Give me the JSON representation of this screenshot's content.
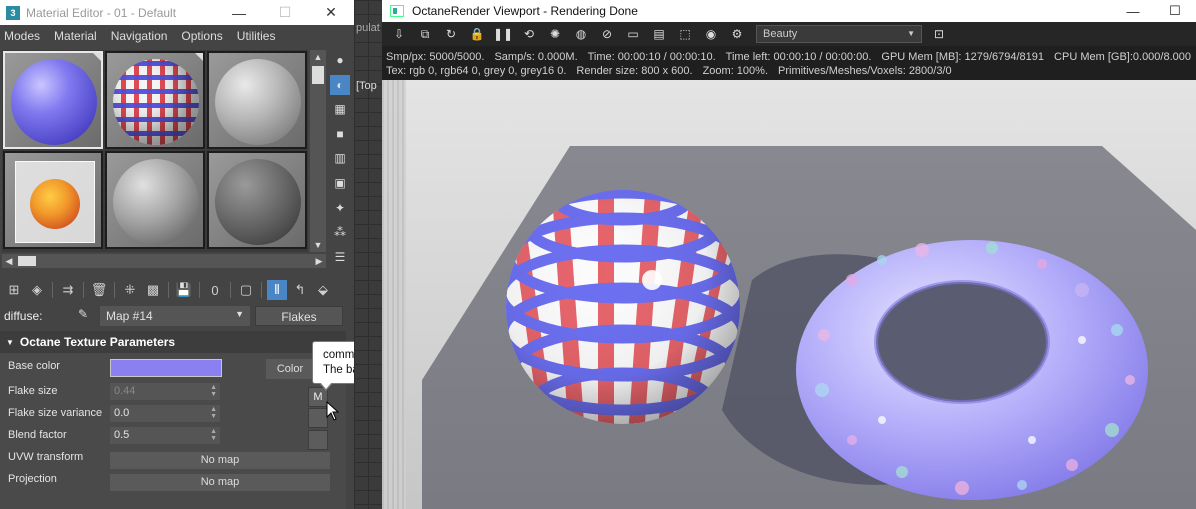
{
  "material_editor": {
    "app_icon": "3",
    "title": "Material Editor - 01 - Default",
    "window_buttons": [
      "—",
      "☐",
      "✕"
    ],
    "menu": [
      "Modes",
      "Material",
      "Navigation",
      "Options",
      "Utilities"
    ],
    "diffuse": {
      "label": "diffuse:",
      "map_name": "Map #14",
      "type_button": "Flakes"
    },
    "rollout": {
      "title": "Octane Texture Parameters",
      "params": [
        {
          "label": "Base color",
          "color": "#8b80f2",
          "button": "Color"
        },
        {
          "label": "Flake size",
          "value": "0.44",
          "disabled": true,
          "map_button": "M"
        },
        {
          "label": "Flake size variance",
          "value": "0.0"
        },
        {
          "label": "Blend factor",
          "value": "0.5"
        },
        {
          "label": "UVW transform",
          "map": "No map"
        },
        {
          "label": "Projection",
          "map": "No map"
        }
      ]
    },
    "tooltip": {
      "line1": "common_size (Float value)",
      "line2": "The base size of the flakes."
    }
  },
  "background": {
    "text1": "pulat",
    "text2": "[Top"
  },
  "octane_viewport": {
    "title": "OctaneRender Viewport - Rendering Done",
    "window_buttons": [
      "—",
      "☐"
    ],
    "render_pass": "Beauty",
    "stats_line1": [
      "Smp/px: 5000/5000.",
      "Samp/s: 0.000M.",
      "Time: 00:00:10 / 00:00:10.",
      "Time left: 00:00:10 / 00:00:00.",
      "GPU Mem [MB]: 1279/6794/8191",
      "CPU Mem [GB]:0.000/8.000"
    ],
    "stats_line2": [
      "Tex: rgb 0, rgb64 0, grey 0, grey16 0.",
      "Render size: 800 x 600.",
      "Zoom: 100%.",
      "Primitives/Meshes/Voxels: 2800/3/0"
    ]
  }
}
